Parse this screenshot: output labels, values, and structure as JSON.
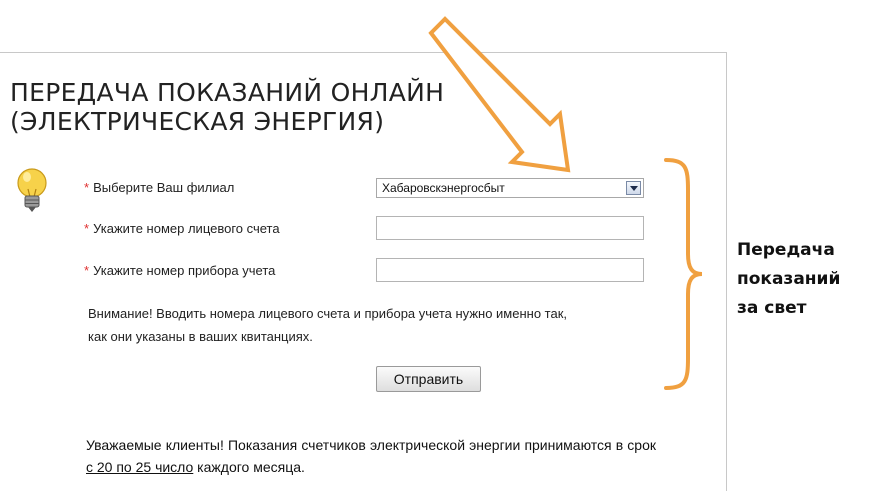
{
  "form": {
    "title_line1": "ПЕРЕДАЧА ПОКАЗАНИЙ ОНЛАЙН",
    "title_line2": "(ЭЛЕКТРИЧЕСКАЯ ЭНЕРГИЯ)",
    "required_mark": "*",
    "branch_label": "Выберите Ваш филиал",
    "branch_value": "Хабаровскэнергосбыт",
    "account_label": "Укажите номер лицевого счета",
    "account_value": "",
    "meter_label": "Укажите номер прибора учета",
    "meter_value": "",
    "note_line1": "Внимание! Вводить номера лицевого счета и прибора учета нужно именно так,",
    "note_line2": "как они указаны в ваших квитанциях.",
    "submit_label": "Отправить",
    "footer_part1": "Уважаемые клиенты! Показания счетчиков электрической энергии принимаются в срок ",
    "footer_link": "с 20 по 25 число",
    "footer_part2": " каждого месяца."
  },
  "annotation": {
    "line1": "Передача",
    "line2": "показаний",
    "line3": "за свет"
  },
  "colors": {
    "accent_orange": "#f0a040",
    "required_red": "#e03030"
  },
  "icons": {
    "bulb": "lightbulb-icon",
    "arrow": "down-arrow-icon",
    "brace": "right-curly-brace-icon",
    "dropdown": "chevron-down-icon"
  }
}
